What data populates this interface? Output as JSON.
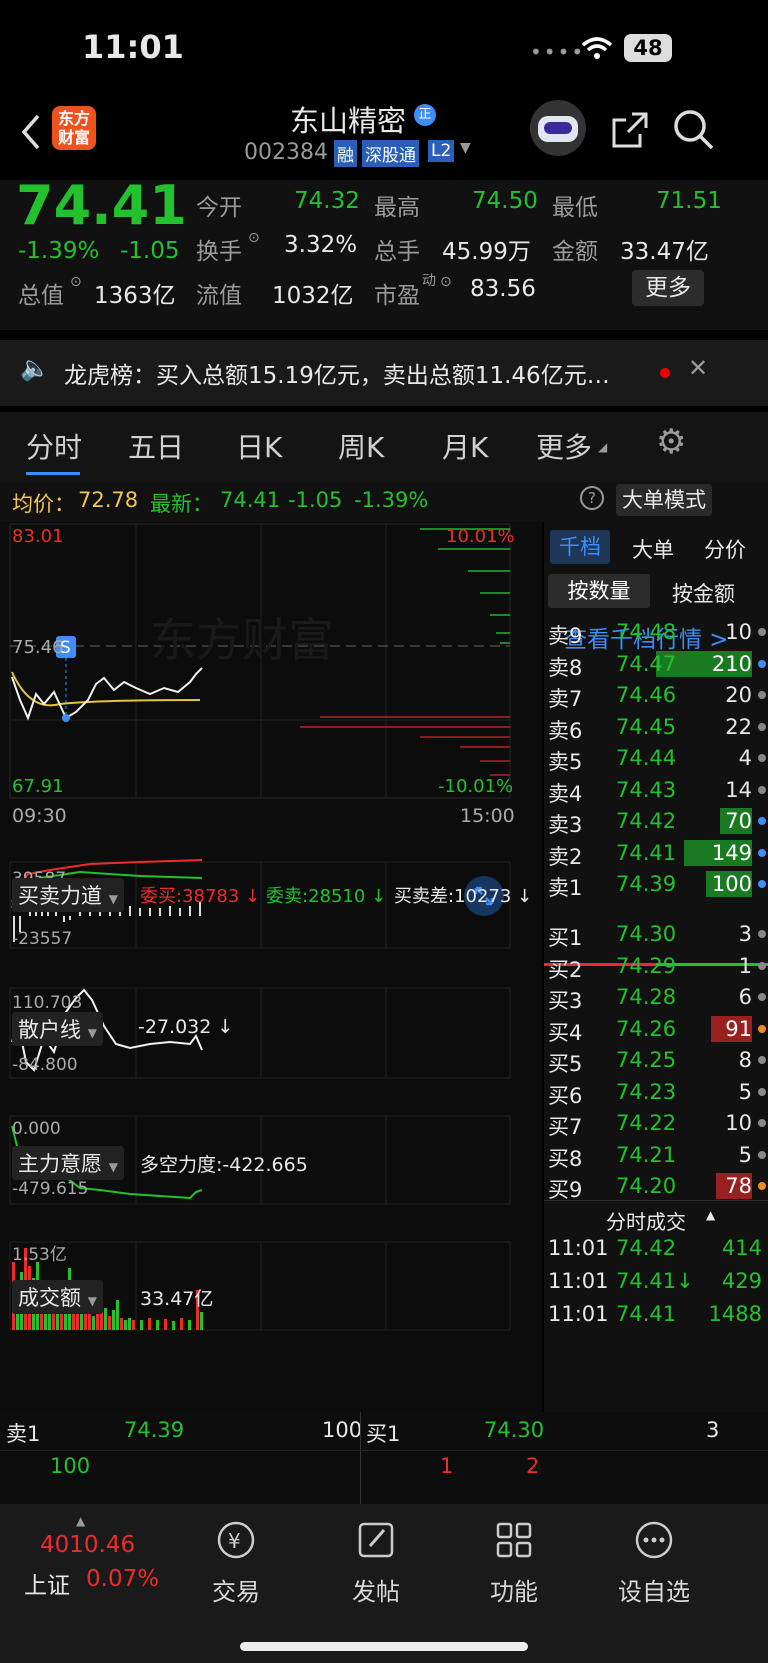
{
  "status": {
    "time": "11:01",
    "battery": "48"
  },
  "header": {
    "logo_line1": "东方",
    "logo_line2": "财富",
    "name": "东山精密",
    "badge": "正",
    "code": "002384",
    "tag_rong": "融",
    "tag_sgt": "深股通",
    "tag_l2": "L2"
  },
  "quote": {
    "price": "74.41",
    "pct": "-1.39%",
    "chg": "-1.05",
    "open_l": "今开",
    "open": "74.32",
    "high_l": "最高",
    "high": "74.50",
    "low_l": "最低",
    "low": "71.51",
    "turn_l": "换手",
    "turn": "3.32%",
    "vol_l": "总手",
    "vol": "45.99万",
    "amt_l": "金额",
    "amt": "33.47亿",
    "mcap_l": "总值",
    "mcap": "1363亿",
    "float_l": "流值",
    "float": "1032亿",
    "pe_l": "市盈",
    "pe_sup": "动",
    "pe": "83.56",
    "more": "更多"
  },
  "ticker": {
    "text": "龙虎榜：买入总额15.19亿元，卖出总额11.46亿元…"
  },
  "tabs": [
    "分时",
    "五日",
    "日K",
    "周K",
    "月K",
    "更多"
  ],
  "avgline": {
    "avg_label": "均价：",
    "avg": "72.78",
    "last_label": "最新：",
    "last": "74.41",
    "chg": "-1.05",
    "pct": "-1.39%",
    "mode": "大单模式"
  },
  "chart": {
    "top": "83.01",
    "mid": "75.46",
    "bottom": "67.91",
    "top_pct": "10.01%",
    "bottom_pct": "-10.01%",
    "t_start": "09:30",
    "t_end": "15:00",
    "s_marker": "S",
    "watermark": "东方财富"
  },
  "ind1": {
    "label": "买卖力道",
    "buy": "委买:38783 ↓",
    "sell": "委卖:28510 ↓",
    "diff": "买卖差:10273 ↓",
    "v1": "39587",
    "v2": "-23557"
  },
  "ind2": {
    "label": "散户线",
    "val": "-27.032 ↓",
    "v1": "110.703",
    "v2": "-84.800"
  },
  "ind3": {
    "label": "主力意愿",
    "val": "多空力度:-422.665",
    "v1": "0.000",
    "v2": "-479.615"
  },
  "ind4": {
    "label": "成交额",
    "val": "33.47亿",
    "v1": "1.53亿"
  },
  "book": {
    "tab1": "千档",
    "tab2": "大单",
    "tab3": "分价",
    "sub1": "按数量",
    "sub2": "按金额",
    "link": "查看千档行情 >",
    "asks": [
      {
        "l": "卖9",
        "p": "74.48",
        "q": "10",
        "bar": 0,
        "dot": "#888"
      },
      {
        "l": "卖8",
        "p": "74.47",
        "q": "210",
        "bar": 1,
        "dot": "#3e8ef7"
      },
      {
        "l": "卖7",
        "p": "74.46",
        "q": "20",
        "bar": 0,
        "dot": "#888"
      },
      {
        "l": "卖6",
        "p": "74.45",
        "q": "22",
        "bar": 0,
        "dot": "#888"
      },
      {
        "l": "卖5",
        "p": "74.44",
        "q": "4",
        "bar": 0,
        "dot": "#888"
      },
      {
        "l": "卖4",
        "p": "74.43",
        "q": "14",
        "bar": 0,
        "dot": "#888"
      },
      {
        "l": "卖3",
        "p": "74.42",
        "q": "70",
        "bar": 0.33,
        "dot": "#3e8ef7"
      },
      {
        "l": "卖2",
        "p": "74.41",
        "q": "149",
        "bar": 0.71,
        "dot": "#3e8ef7"
      },
      {
        "l": "卖1",
        "p": "74.39",
        "q": "100",
        "bar": 0.48,
        "dot": "#3e8ef7"
      }
    ],
    "bids": [
      {
        "l": "买1",
        "p": "74.30",
        "q": "3",
        "bar": 0,
        "dot": "#888"
      },
      {
        "l": "买2",
        "p": "74.29",
        "q": "1",
        "bar": 0,
        "dot": "#888"
      },
      {
        "l": "买3",
        "p": "74.28",
        "q": "6",
        "bar": 0,
        "dot": "#888"
      },
      {
        "l": "买4",
        "p": "74.26",
        "q": "91",
        "bar": 0.43,
        "dot": "#f08a24"
      },
      {
        "l": "买5",
        "p": "74.25",
        "q": "8",
        "bar": 0,
        "dot": "#888"
      },
      {
        "l": "买6",
        "p": "74.23",
        "q": "5",
        "bar": 0,
        "dot": "#888"
      },
      {
        "l": "买7",
        "p": "74.22",
        "q": "10",
        "bar": 0,
        "dot": "#888"
      },
      {
        "l": "买8",
        "p": "74.21",
        "q": "5",
        "bar": 0,
        "dot": "#888"
      },
      {
        "l": "买9",
        "p": "74.20",
        "q": "78",
        "bar": 0.37,
        "dot": "#f08a24"
      }
    ],
    "ticks_title": "分时成交",
    "ticks": [
      {
        "t": "11:01",
        "p": "74.42",
        "q": "414"
      },
      {
        "t": "11:01",
        "p": "74.41↓",
        "q": "429"
      },
      {
        "t": "11:01",
        "p": "74.41",
        "q": "1488"
      }
    ]
  },
  "bottom": {
    "s_l": "卖1",
    "s_p": "74.39",
    "s_q": "100",
    "b_l": "买1",
    "b_p": "74.30",
    "b_q": "3",
    "n1": "100",
    "n2": "1",
    "n3": "2"
  },
  "dock": {
    "index_val": "4010.46",
    "index_name": "上证",
    "index_pct": "0.07%",
    "trade": "交易",
    "post": "发帖",
    "func": "功能",
    "watch": "设自选"
  }
}
